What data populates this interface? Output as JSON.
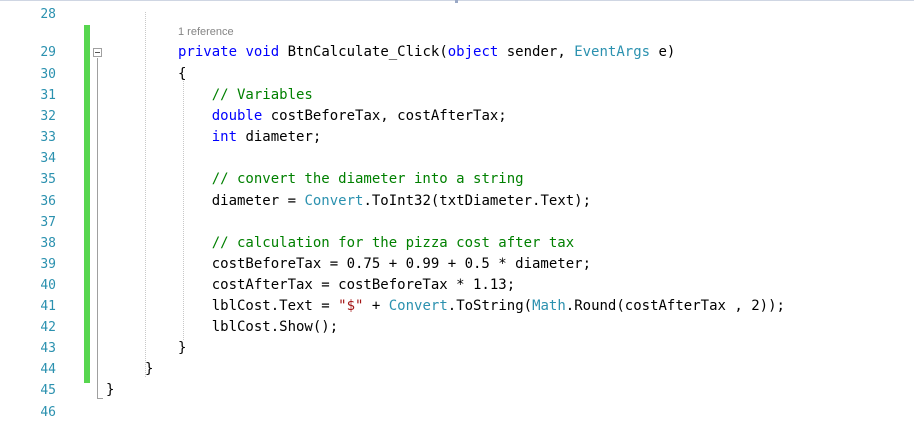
{
  "top_line": "1 reference",
  "lines": [
    {
      "no": "28",
      "segs": []
    },
    {
      "no": "29",
      "segs": [
        {
          "t": "private",
          "c": "kw"
        },
        {
          "t": " "
        },
        {
          "t": "void",
          "c": "kw"
        },
        {
          "t": " BtnCalculate_Click("
        },
        {
          "t": "object",
          "c": "kw"
        },
        {
          "t": " sender, "
        },
        {
          "t": "EventArgs",
          "c": "ty"
        },
        {
          "t": " e)"
        }
      ]
    },
    {
      "no": "30",
      "segs": [
        {
          "t": "{"
        }
      ]
    },
    {
      "no": "31",
      "segs": [
        {
          "t": "    "
        },
        {
          "t": "// Variables",
          "c": "cm"
        }
      ]
    },
    {
      "no": "32",
      "segs": [
        {
          "t": "    "
        },
        {
          "t": "double",
          "c": "kw"
        },
        {
          "t": " costBeforeTax, costAfterTax;"
        }
      ]
    },
    {
      "no": "33",
      "segs": [
        {
          "t": "    "
        },
        {
          "t": "int",
          "c": "kw"
        },
        {
          "t": " diameter;"
        }
      ]
    },
    {
      "no": "34",
      "segs": []
    },
    {
      "no": "35",
      "segs": [
        {
          "t": "    "
        },
        {
          "t": "// convert the diameter into a string",
          "c": "cm"
        }
      ]
    },
    {
      "no": "36",
      "segs": [
        {
          "t": "    diameter = "
        },
        {
          "t": "Convert",
          "c": "ty"
        },
        {
          "t": ".ToInt32(txtDiameter.Text);"
        }
      ]
    },
    {
      "no": "37",
      "segs": []
    },
    {
      "no": "38",
      "segs": [
        {
          "t": "    "
        },
        {
          "t": "// calculation for the pizza cost after tax",
          "c": "cm"
        }
      ]
    },
    {
      "no": "39",
      "segs": [
        {
          "t": "    costBeforeTax = 0.75 + 0.99 + 0.5 * diameter;"
        }
      ]
    },
    {
      "no": "40",
      "segs": [
        {
          "t": "    costAfterTax = costBeforeTax * 1.13;"
        }
      ]
    },
    {
      "no": "41",
      "segs": [
        {
          "t": "    lblCost.Text = "
        },
        {
          "t": "\"$\"",
          "c": "st"
        },
        {
          "t": " + "
        },
        {
          "t": "Convert",
          "c": "ty"
        },
        {
          "t": ".ToString("
        },
        {
          "t": "Math",
          "c": "ty"
        },
        {
          "t": ".Round(costAfterTax , 2));"
        }
      ]
    },
    {
      "no": "42",
      "segs": [
        {
          "t": "    lblCost.Show();"
        }
      ]
    },
    {
      "no": "43",
      "segs": [
        {
          "t": "}"
        }
      ]
    },
    {
      "no": "44",
      "segs": [
        {
          "t": "}"
        }
      ]
    },
    {
      "no": "45",
      "segs": [
        {
          "t": "}"
        }
      ]
    },
    {
      "no": "46",
      "segs": []
    }
  ],
  "colors": {
    "keyword": "#0000ff",
    "type": "#2b91af",
    "comment": "#008000",
    "string": "#a31515",
    "change_bar": "#57d64f"
  }
}
